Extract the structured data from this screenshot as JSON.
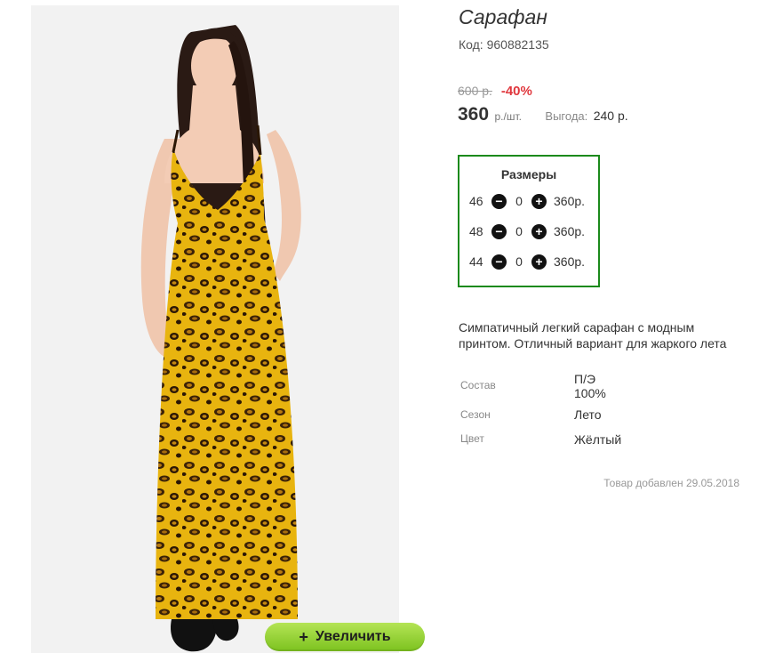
{
  "product": {
    "title": "Сарафан",
    "code": "Код: 960882135",
    "old_price": "600 р.",
    "discount": "-40%",
    "price": "360",
    "price_unit": "р./шт.",
    "savings_label": "Выгода:",
    "savings_value": "240 р.",
    "description": "Симпатичный легкий сарафан с модным принтом. Отличный вариант для жаркого лета",
    "added_date": "Товар добавлен 29.05.2018"
  },
  "sizes": {
    "title": "Размеры",
    "rows": [
      {
        "size": "46",
        "qty": "0",
        "price": "360р."
      },
      {
        "size": "48",
        "qty": "0",
        "price": "360р."
      },
      {
        "size": "44",
        "qty": "0",
        "price": "360р."
      }
    ]
  },
  "properties": [
    {
      "label": "Состав",
      "value_line1": "П/Э",
      "value_line2": "100%"
    },
    {
      "label": "Сезон",
      "value_line1": "Лето"
    },
    {
      "label": "Цвет",
      "value_line1": "Жёлтый"
    }
  ],
  "zoom_button": {
    "label": "Увеличить",
    "icon": "plus-icon"
  },
  "colors": {
    "accent_green": "#1b8a1b",
    "button_green": "#8fd12f",
    "discount_red": "#e0383e",
    "dress_yellow": "#e9b413"
  }
}
